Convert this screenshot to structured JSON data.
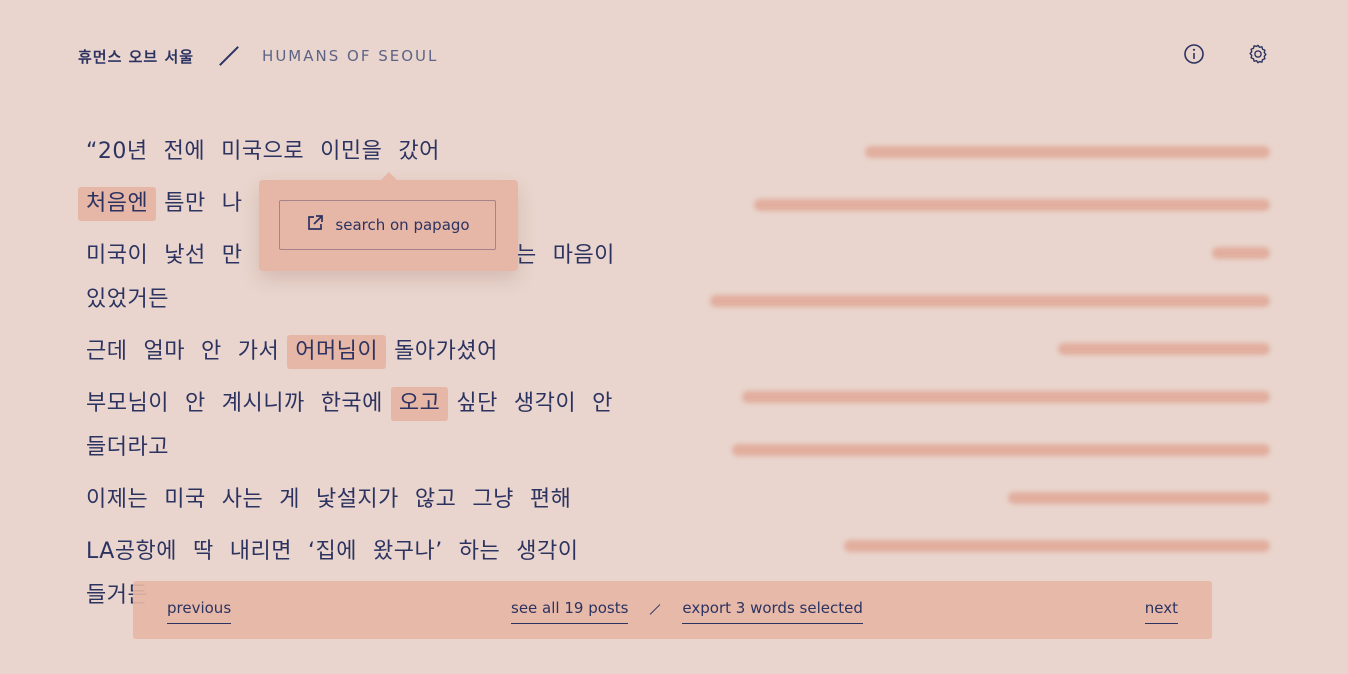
{
  "header": {
    "brand_korean": "휴먼스 오브 서울",
    "brand_english": "HUMANS OF SEOUL",
    "icons": [
      "info-icon",
      "gear-icon"
    ]
  },
  "story": {
    "lines": [
      {
        "words": [
          {
            "text": "“20년"
          },
          {
            "text": "전에"
          },
          {
            "text": "미국으로"
          },
          {
            "text": "이민을"
          },
          {
            "text": "갔어"
          }
        ]
      },
      {
        "words": [
          {
            "text": "처음엔",
            "selected": true
          },
          {
            "text": "틈만"
          },
          {
            "text": "나"
          }
        ]
      },
      {
        "words": [
          {
            "text": "미국이"
          },
          {
            "text": "낯선"
          },
          {
            "text": "만"
          },
          {
            "text": ""
          },
          {
            "text": ""
          },
          {
            "text": "싶다는"
          },
          {
            "text": "마음이"
          },
          {
            "text": "있었거든"
          }
        ]
      },
      {
        "words": [
          {
            "text": "근데"
          },
          {
            "text": "얼마"
          },
          {
            "text": "안"
          },
          {
            "text": "가서"
          },
          {
            "text": "어머님이",
            "selected": true
          },
          {
            "text": "돌아가셨어"
          }
        ]
      },
      {
        "words": [
          {
            "text": "부모님이"
          },
          {
            "text": "안"
          },
          {
            "text": "계시니까"
          },
          {
            "text": "한국에"
          },
          {
            "text": "오고",
            "selected": true
          },
          {
            "text": "싶단"
          },
          {
            "text": "생각이"
          },
          {
            "text": "안"
          },
          {
            "text": "들더라고"
          }
        ]
      },
      {
        "words": [
          {
            "text": "이제는"
          },
          {
            "text": "미국"
          },
          {
            "text": "사는"
          },
          {
            "text": "게"
          },
          {
            "text": "낯설지가"
          },
          {
            "text": "않고"
          },
          {
            "text": "그냥"
          },
          {
            "text": "편해"
          }
        ]
      },
      {
        "words": [
          {
            "text": "LA공항에"
          },
          {
            "text": "딱"
          },
          {
            "text": "내리면"
          },
          {
            "text": "‘집에"
          },
          {
            "text": "왔구나’"
          },
          {
            "text": "하는"
          },
          {
            "text": "생각이"
          },
          {
            "text": "들거든"
          }
        ]
      }
    ]
  },
  "popup": {
    "label": "search on papago",
    "icon": "external-link-icon"
  },
  "bottom_bar": {
    "previous": "previous",
    "see_all": "see all 19 posts",
    "export": "export 3 words selected",
    "next": "next"
  },
  "colors": {
    "background": "#e9d5cd",
    "accent": "#e6b6a6",
    "text": "#2c3361"
  }
}
